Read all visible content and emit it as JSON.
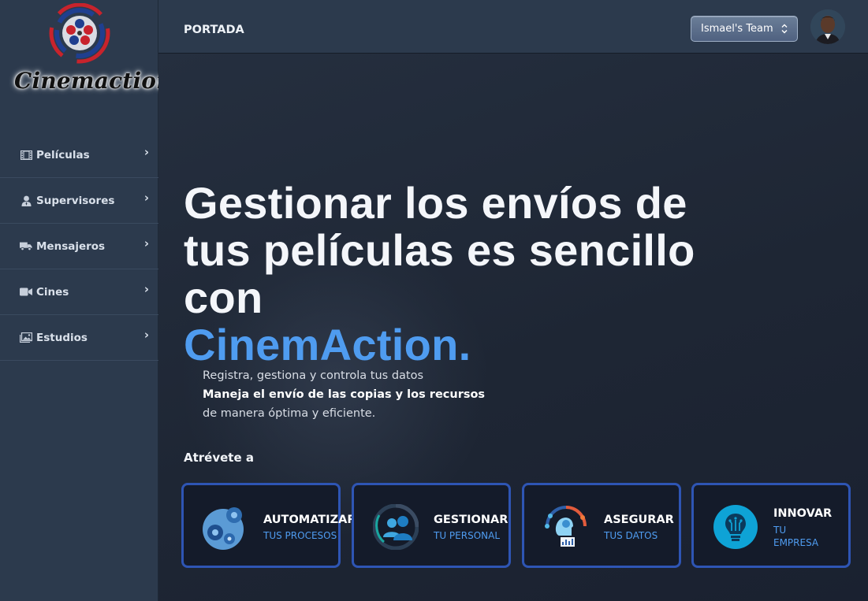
{
  "app": {
    "logo_text": "Cinemaction"
  },
  "sidebar": {
    "items": [
      {
        "label": "Películas",
        "icon": "film-icon"
      },
      {
        "label": "Supervisores",
        "icon": "user-tie-icon"
      },
      {
        "label": "Mensajeros",
        "icon": "truck-icon"
      },
      {
        "label": "Cines",
        "icon": "video-camera-icon"
      },
      {
        "label": "Estudios",
        "icon": "images-icon"
      }
    ]
  },
  "header": {
    "title": "PORTADA",
    "team_select": "Ismael's Team"
  },
  "hero": {
    "line1": "Gestionar los envíos de",
    "line2": "tus películas es sencillo",
    "line3": "con",
    "brand": "CinemAction.",
    "sub1": "Registra, gestiona y controla tus datos",
    "sub2": "Maneja el envío de las copias y los recursos",
    "sub3": "de manera óptima y eficiente.",
    "dare": "Atrévete a"
  },
  "cards": [
    {
      "title": "AUTOMATIZAR",
      "subtitle": "TUS PROCESOS"
    },
    {
      "title": "GESTIONAR",
      "subtitle": "TU PERSONAL"
    },
    {
      "title": "ASEGURAR",
      "subtitle": "TUS DATOS"
    },
    {
      "title": "INNOVAR",
      "subtitle": "TU EMPRESA"
    }
  ],
  "colors": {
    "accent": "#4f9cf0",
    "card_border": "#2e55b4",
    "sidebar_bg": "#2c3a4d"
  }
}
